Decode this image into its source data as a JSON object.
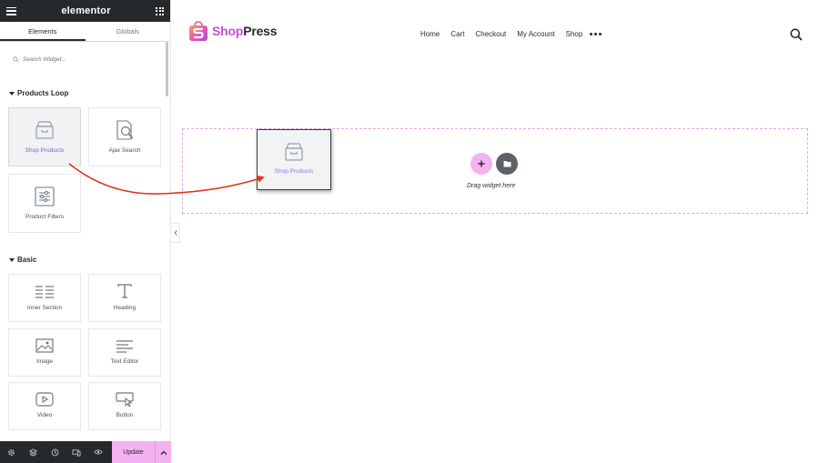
{
  "panel": {
    "brand": "elementor",
    "tabs": [
      "Elements",
      "Globals"
    ],
    "search_placeholder": "Search Widget...",
    "sections": [
      {
        "title": "Products Loop",
        "widgets": [
          "Shop Products",
          "Ajax Search",
          "Product Filters"
        ]
      },
      {
        "title": "Basic",
        "widgets": [
          "Inner Section",
          "Heading",
          "Image",
          "Text Editor",
          "Video",
          "Button"
        ]
      }
    ],
    "footer": {
      "update_label": "Update"
    }
  },
  "site": {
    "logo_part1": "Shop",
    "logo_part2": "Press",
    "nav": [
      "Home",
      "Cart",
      "Checkout",
      "My Account",
      "Shop"
    ]
  },
  "canvas": {
    "drag_hint": "Drag widget here",
    "dragging_widget": "Shop Products"
  },
  "colors": {
    "accent_pink": "#f5b2f0",
    "panel_dark": "#26292c",
    "arrow_red": "#e0341d",
    "logo_purple": "#c34fd6"
  }
}
